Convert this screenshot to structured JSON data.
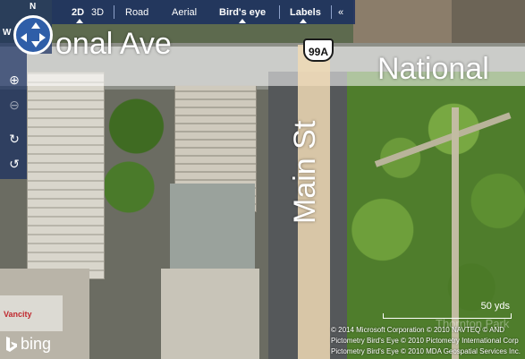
{
  "toolbar": {
    "view_2d": "2D",
    "view_3d": "3D",
    "road": "Road",
    "aerial": "Aerial",
    "birds_eye": "Bird's eye",
    "labels": "Labels",
    "collapse": "«"
  },
  "nav": {
    "north": "N",
    "west": "W",
    "zoom_in_icon": "zoom-in-icon",
    "zoom_out_icon": "zoom-out-icon",
    "rotate_cw_icon": "rotate-clockwise-icon",
    "rotate_ccw_icon": "rotate-counterclockwise-icon"
  },
  "map": {
    "labels": {
      "national_ave_left": "onal Ave",
      "national_right": "National",
      "main_st": "Main St",
      "shield": "99A",
      "faded": "Thornton Park"
    },
    "scale": "50 yds",
    "brand": "bing",
    "copyright": [
      "© 2014 Microsoft Corporation   © 2010 NAVTEQ   © AND",
      "Pictometry Bird's Eye © 2010 Pictometry International Corp",
      "Pictometry Bird's Eye © 2010 MDA Geospatial Services Inc."
    ],
    "building_sign": "Vancity"
  },
  "colors": {
    "toolbar_bg": "#162c60",
    "park_green": "#4f7d2c",
    "road_overlay": "#f0d9b5"
  }
}
